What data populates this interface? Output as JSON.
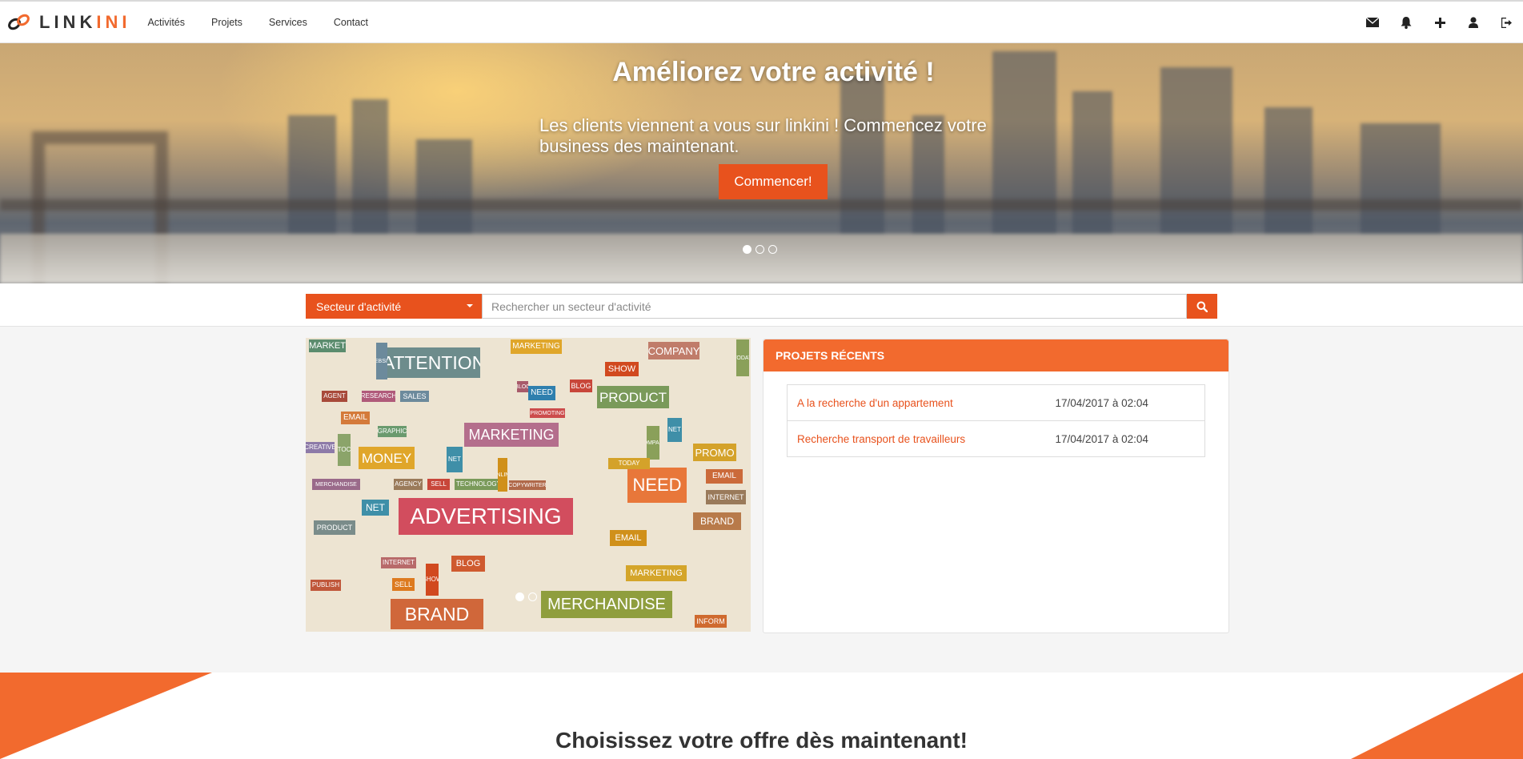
{
  "brand": {
    "name_part1": "LINK",
    "name_part2": "INI",
    "accent": "#f26a2e"
  },
  "nav": {
    "links": [
      "Activités",
      "Projets",
      "Services",
      "Contact"
    ]
  },
  "nav_icons": [
    "envelope-icon",
    "bell-icon",
    "plus-icon",
    "user-icon",
    "sign-out-icon"
  ],
  "hero": {
    "title": "Améliorez votre activité !",
    "subtitle": "Les clients viennent a vous sur linkini ! Commencez votre business des maintenant.",
    "cta": "Commencer!",
    "slides": 3,
    "active_slide": 1
  },
  "search": {
    "sector_label": "Secteur d'activité",
    "placeholder": "Rechercher un secteur d'activité"
  },
  "cloud": {
    "words": [
      "MARKET",
      "ATTENTION",
      "MARKETING",
      "COMPANY",
      "SHOW",
      "PRODUCT",
      "NEED",
      "BLOG",
      "RESEARCH",
      "SALES",
      "EMAIL",
      "AGENT",
      "MONEY",
      "STOCK",
      "PROMO",
      "NEED",
      "EMAIL",
      "INTERNET",
      "ADVERTISING",
      "BRAND",
      "PRODUCT",
      "NET",
      "BLOG",
      "EMAIL",
      "BRAND",
      "MARKETING",
      "MERCHANDISE",
      "SELL",
      "INTERNET",
      "PUBLISH",
      "SHOW",
      "BLOG",
      "TODAY",
      "CREATIVE",
      "WEBSITE",
      "INFORM",
      "GRAPHIC",
      "TECHNOLOGY",
      "PROMOTING",
      "COPYWRITER",
      "AGENCY",
      "SELL",
      "MERCHANDISE",
      "NET",
      "ONLINE",
      "MARKETING",
      "NET",
      "COMPANY",
      "TODAY"
    ]
  },
  "projects": {
    "header": "PROJETS RÉCENTS",
    "rows": [
      {
        "title": "A la recherche d'un appartement",
        "date": "17/04/2017 à 02:04"
      },
      {
        "title": "Recherche transport de travailleurs",
        "date": "17/04/2017 à 02:04"
      }
    ]
  },
  "offer": {
    "title": "Choisissez votre offre dès maintenant!"
  },
  "colors": {
    "primary": "#e8521d",
    "header": "#f26a2e"
  }
}
